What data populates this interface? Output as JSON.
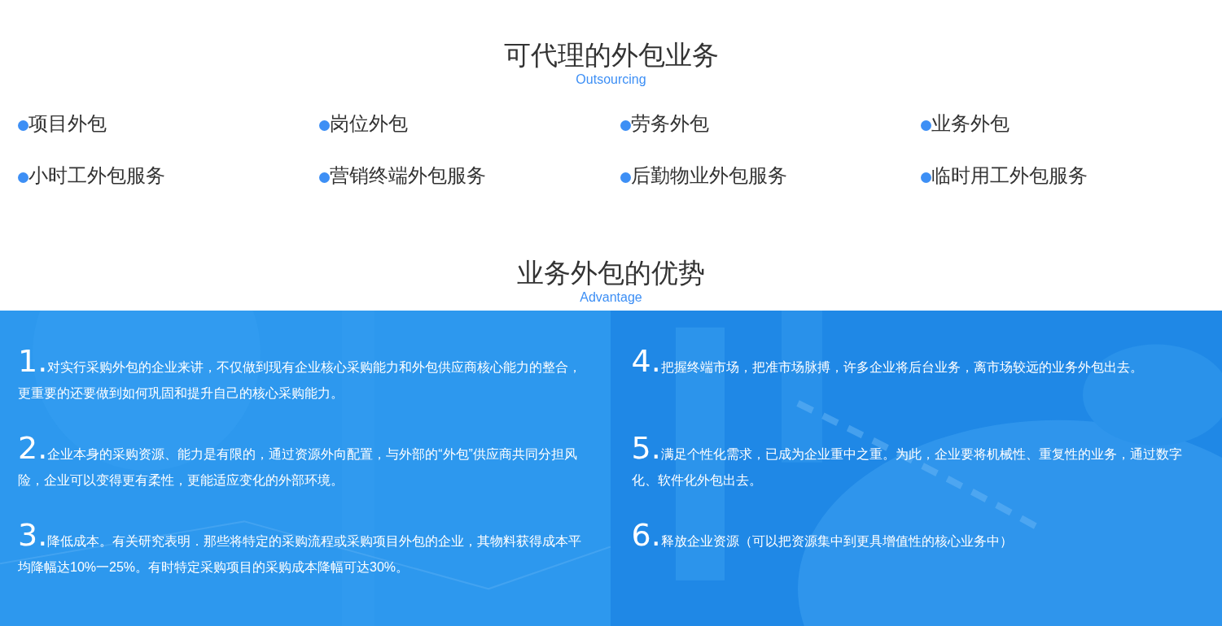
{
  "services": {
    "title": "可代理的外包业务",
    "subtitle": "Outsourcing",
    "items": [
      {
        "label": "项目外包"
      },
      {
        "label": "岗位外包"
      },
      {
        "label": "劳务外包"
      },
      {
        "label": "业务外包"
      },
      {
        "label": "小时工外包服务"
      },
      {
        "label": "营销终端外包服务"
      },
      {
        "label": "后勤物业外包服务"
      },
      {
        "label": "临时用工外包服务"
      }
    ]
  },
  "advantages": {
    "title": "业务外包的优势",
    "subtitle": "Advantage",
    "items": [
      {
        "number": "1.",
        "text": "对实行采购外包的企业来讲，不仅做到现有企业核心采购能力和外包供应商核心能力的整合，更重要的还要做到如何巩固和提升自己的核心采购能力。"
      },
      {
        "number": "2.",
        "text": "企业本身的采购资源、能力是有限的，通过资源外向配置，与外部的“外包”供应商共同分担风险，企业可以变得更有柔性，更能适应变化的外部环境。"
      },
      {
        "number": "3.",
        "text": "降低成本。有关研究表明．那些将特定的采购流程或采购项目外包的企业，其物料获得成本平均降幅达10%一25%。有时特定采购项目的采购成本降幅可达30%。"
      },
      {
        "number": "4.",
        "text": "把握终端市场，把准市场脉搏，许多企业将后台业务，离市场较远的业务外包出去。"
      },
      {
        "number": "5.",
        "text": "满足个性化需求，已成为企业重中之重。为此，企业要将机械性、重复性的业务，通过数字化、软件化外包出去。"
      },
      {
        "number": "6.",
        "text": "释放企业资源（可以把资源集中到更具增值性的核心业务中）"
      }
    ]
  }
}
